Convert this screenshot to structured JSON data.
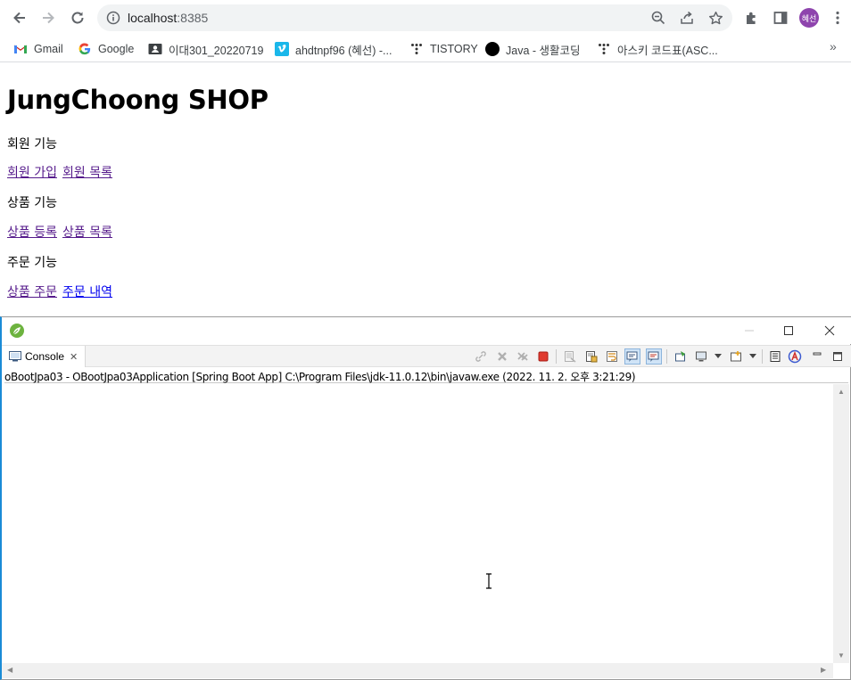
{
  "browser": {
    "url_host": "localhost",
    "url_port": ":8385",
    "profile_initials": "혜선",
    "bookmarks": [
      {
        "label": "Gmail",
        "icon": "gmail-icon"
      },
      {
        "label": "Google",
        "icon": "google-icon"
      },
      {
        "label": "이대301_20220719",
        "icon": "contact-card-icon"
      },
      {
        "label": "ahdtnpf96 (혜선) -...",
        "icon": "vimeo-icon"
      },
      {
        "label": "TISTORY",
        "icon": "tistory-icon"
      },
      {
        "label": "Java - 생활코딩",
        "icon": "black-circle-icon"
      },
      {
        "label": "아스키 코드표(ASC...",
        "icon": "tistory-icon"
      }
    ],
    "bookmarks_overflow": "»"
  },
  "page": {
    "title": "JungChoong SHOP",
    "sections": [
      {
        "heading": "회원 기능",
        "links": [
          {
            "label": "회원 가입",
            "visited": true
          },
          {
            "label": "회원 목록",
            "visited": true
          }
        ]
      },
      {
        "heading": "상품 기능",
        "links": [
          {
            "label": "상품 등록",
            "visited": true
          },
          {
            "label": "상품 목록",
            "visited": true
          }
        ]
      },
      {
        "heading": "주문 기능",
        "links": [
          {
            "label": "상품 주문",
            "visited": true
          },
          {
            "label": "주문 내역",
            "visited": false
          }
        ]
      }
    ]
  },
  "eclipse": {
    "tab_label": "Console",
    "status_line": "oBootJpa03 - OBootJpa03Application [Spring Boot App] C:\\Program Files\\jdk-11.0.12\\bin\\javaw.exe  (2022. 11. 2. 오후 3:21:29)",
    "colors": {
      "accent_blue": "#1a8bd6",
      "terminate_red": "#e03a2f",
      "spring_green": "#6db33f"
    }
  }
}
